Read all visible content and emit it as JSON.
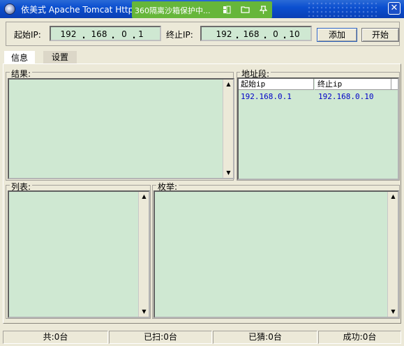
{
  "window": {
    "title": "依美式 Apache Tomcat Http",
    "close_glyph": "✕"
  },
  "sandbox": {
    "text": "360隔离沙箱保护中...",
    "icons": [
      "window-icon",
      "folder-icon",
      "pin-icon"
    ]
  },
  "controls": {
    "start_ip_label": "起始IP:",
    "start_ip": [
      "192",
      "168",
      "0",
      "1"
    ],
    "end_ip_label": "终止IP:",
    "end_ip": [
      "192",
      "168",
      "0",
      "10"
    ],
    "add_label": "添加",
    "start_label": "开始"
  },
  "tabs": [
    {
      "label": "信息",
      "active": true
    },
    {
      "label": "设置",
      "active": false
    }
  ],
  "panels": {
    "results_label": "结果:",
    "range_label": "地址段:",
    "list_label": "列表:",
    "enum_label": "枚举:"
  },
  "range_table": {
    "headers": [
      "起始ip",
      "终止ip"
    ],
    "rows": [
      [
        "192.168.0.1",
        "192.168.0.10"
      ]
    ]
  },
  "status": {
    "total": "共:0台",
    "scanned": "已扫:0台",
    "guessed": "已猜:0台",
    "success": "成功:0台"
  },
  "colors": {
    "title_bar": "#0b4fd0",
    "sandbox_bar": "#66b63a",
    "panel_green": "#cfe8d2",
    "window_bg": "#ece9d8",
    "table_text": "#0000c8"
  }
}
